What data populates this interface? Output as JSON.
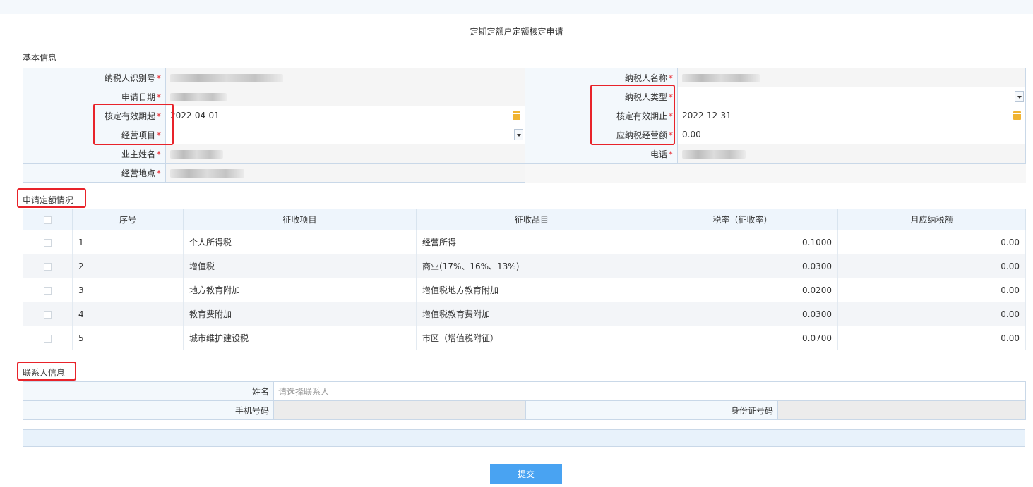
{
  "page": {
    "title": "定期定额户定额核定申请"
  },
  "basic_info": {
    "section_title": "基本信息",
    "taxpayer_id_label": "纳税人识别号",
    "taxpayer_name_label": "纳税人名称",
    "apply_date_label": "申请日期",
    "taxpayer_type_label": "纳税人类型",
    "valid_from_label": "核定有效期起",
    "valid_from_value": "2022-04-01",
    "valid_to_label": "核定有效期止",
    "valid_to_value": "2022-12-31",
    "business_item_label": "经营项目",
    "taxable_amount_label": "应纳税经营额",
    "taxable_amount_value": "0.00",
    "owner_name_label": "业主姓名",
    "phone_label": "电话",
    "business_location_label": "经营地点",
    "required_mark": "*"
  },
  "quota": {
    "section_title": "申请定额情况",
    "columns": [
      "序号",
      "征收项目",
      "征收品目",
      "税率（征收率）",
      "月应纳税额"
    ],
    "rows": [
      {
        "no": "1",
        "item": "个人所得税",
        "category": "经营所得",
        "rate": "0.1000",
        "monthly_tax": "0.00"
      },
      {
        "no": "2",
        "item": "增值税",
        "category": "商业(17%、16%、13%)",
        "rate": "0.0300",
        "monthly_tax": "0.00"
      },
      {
        "no": "3",
        "item": "地方教育附加",
        "category": "增值税地方教育附加",
        "rate": "0.0200",
        "monthly_tax": "0.00"
      },
      {
        "no": "4",
        "item": "教育费附加",
        "category": "增值税教育费附加",
        "rate": "0.0300",
        "monthly_tax": "0.00"
      },
      {
        "no": "5",
        "item": "城市维护建设税",
        "category": "市区（增值税附征）",
        "rate": "0.0700",
        "monthly_tax": "0.00"
      }
    ]
  },
  "contact": {
    "section_title": "联系人信息",
    "name_label": "姓名",
    "name_placeholder": "请选择联系人",
    "mobile_label": "手机号码",
    "id_card_label": "身份证号码"
  },
  "actions": {
    "submit_label": "提交"
  },
  "icons": {
    "date_picker": "calendar-icon",
    "dropdown": "chevron-down-icon"
  },
  "colors": {
    "required": "#e8232a",
    "highlight_box": "#e8232a",
    "submit_button": "#49a3f2",
    "header_bg": "#eef5fc"
  }
}
